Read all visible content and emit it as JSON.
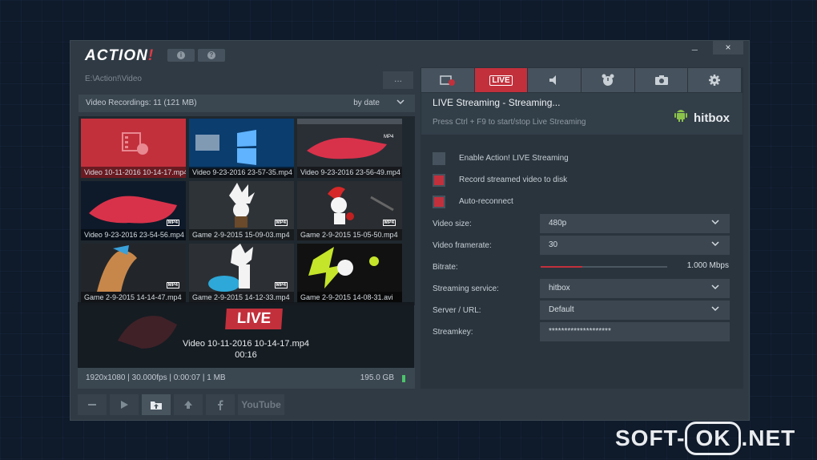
{
  "app": {
    "logo_text": "ACTION",
    "logo_bang": "!",
    "info_button": "i",
    "help_button": "?",
    "minimize": "–",
    "close": "×"
  },
  "left": {
    "path": "E:\\Action!\\Video",
    "browse_button": "...",
    "recordings_header": "Video Recordings: 11 (121 MB)",
    "sort_label": "by date",
    "tiles": [
      {
        "caption": "Video 10-11-2016 10-14-17.mp4"
      },
      {
        "caption": "Video 9-23-2016 23-57-35.mp4"
      },
      {
        "caption": "Video 9-23-2016 23-56-49.mp4"
      },
      {
        "caption": "Video 9-23-2016 23-54-56.mp4"
      },
      {
        "caption": "Game 2-9-2015 15-09-03.mp4"
      },
      {
        "caption": "Game 2-9-2015 15-05-50.mp4"
      },
      {
        "caption": "Game 2-9-2015 14-14-47.mp4"
      },
      {
        "caption": "Game 2-9-2015 14-12-33.mp4"
      },
      {
        "caption": "Game 2-9-2015 14-08-31.avi"
      }
    ],
    "mp4_badge": "MP4",
    "overlay": {
      "live_label": "LIVE",
      "title": "Video 10-11-2016 10-14-17.mp4",
      "duration": "00:16"
    },
    "info_bar": {
      "details": "1920x1080 | 30.000fps | 0:00:07 | 1 MB",
      "disk_free": "195.0 GB"
    },
    "bottom": {
      "youtube_label": "YouTube"
    }
  },
  "right": {
    "tabs": {
      "live_label": "LIVE"
    },
    "status": {
      "title": "LIVE Streaming - Streaming...",
      "hint": "Press Ctrl + F9 to start/stop Live Streaming",
      "service_logo": "hitbox"
    },
    "options": [
      {
        "label": "Enable Action! LIVE Streaming",
        "checked": false
      },
      {
        "label": "Record streamed video to disk",
        "checked": true
      },
      {
        "label": "Auto-reconnect",
        "checked": true
      }
    ],
    "fields": {
      "video_size_label": "Video size:",
      "video_size_value": "480p",
      "framerate_label": "Video framerate:",
      "framerate_value": "30",
      "bitrate_label": "Bitrate:",
      "bitrate_value": "1.000 Mbps",
      "bitrate_fraction": 0.33,
      "service_label": "Streaming service:",
      "service_value": "hitbox",
      "server_label": "Server / URL:",
      "server_value": "Default",
      "streamkey_label": "Streamkey:",
      "streamkey_value": "********************"
    }
  },
  "watermark": {
    "left": "SOFT-",
    "ok": "OK",
    "right": ".NET"
  },
  "colors": {
    "accent": "#c2303c",
    "panel": "#2f3a44",
    "android_green": "#8bc34a"
  }
}
